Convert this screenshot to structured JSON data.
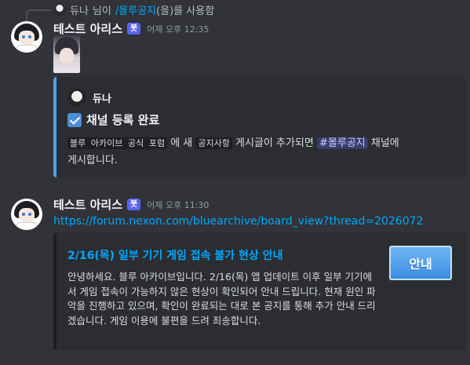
{
  "reply": {
    "user": "듀나",
    "suffix": "님이",
    "command": "/몰루공지",
    "action": "(을)를 사용함"
  },
  "message1": {
    "username": "테스트 아리스",
    "bot_tag": "봇",
    "timestamp": "어제 오후 12:35",
    "embed": {
      "author": "듀나",
      "title": "채널 등록 완료",
      "desc_code1": "블루 아카이브 공식 포럼",
      "desc_text1": "에 새",
      "desc_code2": "공지사항",
      "desc_text2": "게시글이 추가되면",
      "channel": "#몰루공지",
      "desc_text3": "채널에",
      "desc_text4": "게시합니다.",
      "accent_color": "#4e9ff0"
    }
  },
  "message2": {
    "username": "테스트 아리스",
    "bot_tag": "봇",
    "timestamp": "어제 오후 11:30",
    "link": "https://forum.nexon.com/bluearchive/board_view?thread=2026072",
    "embed": {
      "title": "2/16(목) 일부 기기 게임 접속 불가 현상 안내",
      "description": "안녕하세요. 블루 아카이브입니다. 2/16(목) 앱 업데이트 이후 일부 기기에서 게임 접속이 가능하지 않은 현상이 확인되어 안내 드립니다. 현재 원인 파악을 진행하고 있으며, 확인이 완료되는 대로 본 공지를 통해 추가 안내 드리겠습니다. 게임 이용에 불편을 드려 죄송합니다.",
      "thumbnail_text": "안내"
    }
  },
  "colors": {
    "background": "#313338",
    "embed_background": "#2b2d31",
    "link": "#00a8fc",
    "bot_tag": "#5865f2"
  }
}
